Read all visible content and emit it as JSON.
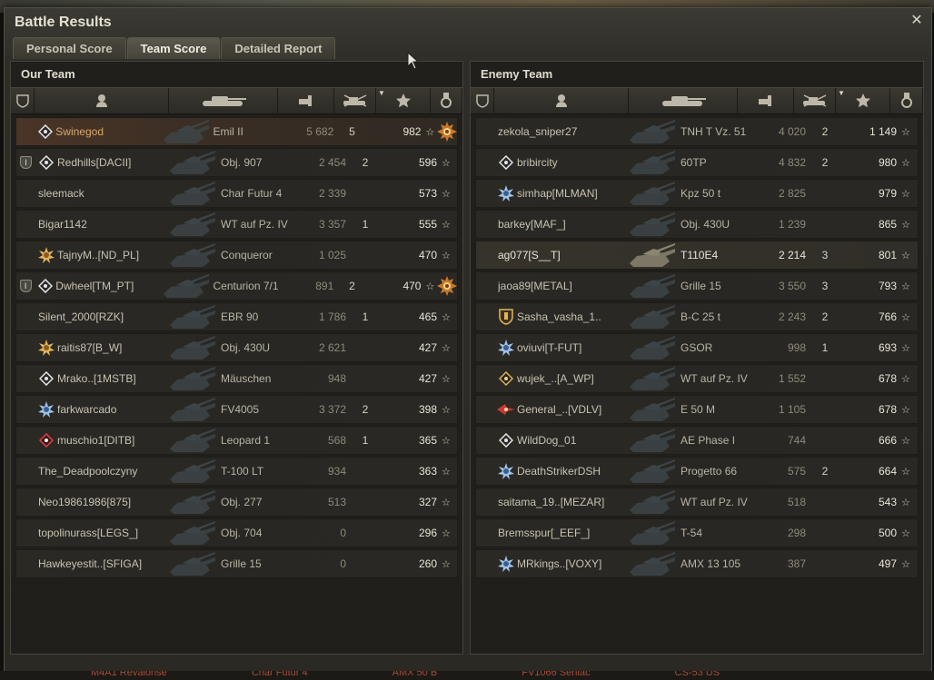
{
  "window": {
    "title": "Battle Results"
  },
  "tabs": [
    {
      "label": "Personal Score",
      "active": false
    },
    {
      "label": "Team Score",
      "active": true
    },
    {
      "label": "Detailed Report",
      "active": false
    }
  ],
  "columns": [
    "platoon",
    "player",
    "vehicle",
    "damage",
    "kills",
    "xp",
    "achievements"
  ],
  "our_team": {
    "title": "Our Team",
    "rows": [
      {
        "badge": "diamond-white",
        "platoon": "",
        "name": "Swinegod",
        "tank": "Emil II",
        "damage": "5 682",
        "kills": "5",
        "xp": "982",
        "medal": true,
        "self": true
      },
      {
        "badge": "diamond-white",
        "platoon": "I",
        "name": "Redhills[DACII]",
        "tank": "Obj. 907",
        "damage": "2 454",
        "kills": "2",
        "xp": "596",
        "medal": false
      },
      {
        "badge": "",
        "platoon": "",
        "name": "sleemack",
        "tank": "Char Futur 4",
        "damage": "2 339",
        "kills": "",
        "xp": "573",
        "medal": false
      },
      {
        "badge": "",
        "platoon": "",
        "name": "Bigar1142",
        "tank": "WT auf Pz. IV",
        "damage": "3 357",
        "kills": "1",
        "xp": "555",
        "medal": false
      },
      {
        "badge": "gold-star",
        "platoon": "",
        "name": "TajnyM..[ND_PL]",
        "tank": "Conqueror",
        "damage": "1 025",
        "kills": "",
        "xp": "470",
        "medal": false
      },
      {
        "badge": "diamond-white",
        "platoon": "I",
        "name": "Dwheel[TM_PT]",
        "tank": "Centurion 7/1",
        "damage": "891",
        "kills": "2",
        "xp": "470",
        "medal": true
      },
      {
        "badge": "",
        "platoon": "",
        "name": "Silent_2000[RZK]",
        "tank": "EBR 90",
        "damage": "1 786",
        "kills": "1",
        "xp": "465",
        "medal": false
      },
      {
        "badge": "gold-star",
        "platoon": "",
        "name": "raitis87[B_W]",
        "tank": "Obj. 430U",
        "damage": "2 621",
        "kills": "",
        "xp": "427",
        "medal": false
      },
      {
        "badge": "diamond-white",
        "platoon": "",
        "name": "Mrako..[1MSTB]",
        "tank": "Mäuschen",
        "damage": "948",
        "kills": "",
        "xp": "427",
        "medal": false
      },
      {
        "badge": "blue-star",
        "platoon": "",
        "name": "farkwarcado",
        "tank": "FV4005",
        "damage": "3 372",
        "kills": "2",
        "xp": "398",
        "medal": false
      },
      {
        "badge": "diamond-red",
        "platoon": "",
        "name": "muschio1[DITB]",
        "tank": "Leopard 1",
        "damage": "568",
        "kills": "1",
        "xp": "365",
        "medal": false
      },
      {
        "badge": "",
        "platoon": "",
        "name": "The_Deadpoolczyny",
        "tank": "T-100 LT",
        "damage": "934",
        "kills": "",
        "xp": "363",
        "medal": false
      },
      {
        "badge": "",
        "platoon": "",
        "name": "Neo19861986[875]",
        "tank": "Obj. 277",
        "damage": "513",
        "kills": "",
        "xp": "327",
        "medal": false
      },
      {
        "badge": "",
        "platoon": "",
        "name": "topolinurass[LEGS_]",
        "tank": "Obj. 704",
        "damage": "0",
        "kills": "",
        "xp": "296",
        "medal": false
      },
      {
        "badge": "",
        "platoon": "",
        "name": "Hawkeyestit..[SFIGA]",
        "tank": "Grille 15",
        "damage": "0",
        "kills": "",
        "xp": "260",
        "medal": false
      }
    ]
  },
  "enemy_team": {
    "title": "Enemy Team",
    "rows": [
      {
        "badge": "",
        "name": "zekola_sniper27",
        "tank": "TNH T Vz. 51",
        "damage": "4 020",
        "kills": "2",
        "xp": "1 149"
      },
      {
        "badge": "diamond-white",
        "name": "bribircity",
        "tank": "60TP",
        "damage": "4 832",
        "kills": "2",
        "xp": "980"
      },
      {
        "badge": "blue-star",
        "name": "simhap[MLMAN]",
        "tank": "Kpz 50 t",
        "damage": "2 825",
        "kills": "",
        "xp": "979"
      },
      {
        "badge": "",
        "name": "barkey[MAF_]",
        "tank": "Obj. 430U",
        "damage": "1 239",
        "kills": "",
        "xp": "865"
      },
      {
        "badge": "",
        "name": "ag077[S__T]",
        "tank": "T110E4",
        "damage": "2 214",
        "kills": "3",
        "xp": "801",
        "highlight": true
      },
      {
        "badge": "",
        "name": "jaoa89[METAL]",
        "tank": "Grille 15",
        "damage": "3 550",
        "kills": "3",
        "xp": "793"
      },
      {
        "badge": "shield-gold",
        "name": "Sasha_vasha_1..",
        "tank": "B-C 25 t",
        "damage": "2 243",
        "kills": "2",
        "xp": "766"
      },
      {
        "badge": "blue-star",
        "name": "oviuvi[T-FUT]",
        "tank": "GSOR",
        "damage": "998",
        "kills": "1",
        "xp": "693"
      },
      {
        "badge": "diamond-gold",
        "name": "wujek_..[A_WP]",
        "tank": "WT auf Pz. IV",
        "damage": "1 552",
        "kills": "",
        "xp": "678"
      },
      {
        "badge": "red-wings",
        "name": "General_..[VDLV]",
        "tank": "E 50 M",
        "damage": "1 105",
        "kills": "",
        "xp": "678"
      },
      {
        "badge": "diamond-white",
        "name": "WildDog_01",
        "tank": "AE Phase I",
        "damage": "744",
        "kills": "",
        "xp": "666"
      },
      {
        "badge": "blue-star",
        "name": "DeathStrikerDSH",
        "tank": "Progetto 66",
        "damage": "575",
        "kills": "2",
        "xp": "664"
      },
      {
        "badge": "",
        "name": "saitama_19..[MEZAR]",
        "tank": "WT auf Pz. IV",
        "damage": "518",
        "kills": "",
        "xp": "543"
      },
      {
        "badge": "",
        "name": "Bremsspur[_EEF_]",
        "tank": "T-54",
        "damage": "298",
        "kills": "",
        "xp": "500"
      },
      {
        "badge": "blue-star",
        "name": "MRkings..[VOXY]",
        "tank": "AMX 13 105",
        "damage": "387",
        "kills": "",
        "xp": "497"
      }
    ]
  },
  "background_strip": [
    "M4A1 Revalorisé",
    "Char Futur 4",
    "AMX 50 B",
    "FV1066 Senlac",
    "CS-53 US"
  ],
  "colors": {
    "self_row": "#4a3526",
    "star": "#d8d3c3",
    "medal": "#c8782a"
  }
}
